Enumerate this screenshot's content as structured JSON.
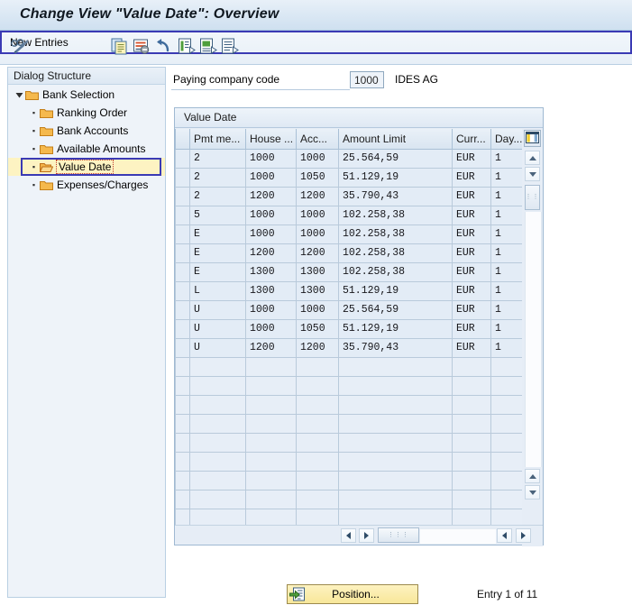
{
  "window": {
    "title": "Change View \"Value Date\": Overview"
  },
  "toolbar": {
    "display_change_icon": "glasses-pencil-icon",
    "new_entries_label": "New Entries",
    "icons": [
      {
        "name": "copy-as-icon",
        "title": "Copy As..."
      },
      {
        "name": "delete-icon",
        "title": "Delete"
      },
      {
        "name": "undo-icon",
        "title": "Undo Change"
      },
      {
        "name": "select-all-icon",
        "title": "Select All"
      },
      {
        "name": "select-block-icon",
        "title": "Select Block"
      },
      {
        "name": "deselect-all-icon",
        "title": "Deselect All"
      }
    ]
  },
  "sidebar": {
    "header": "Dialog Structure",
    "items": [
      {
        "label": "Bank Selection",
        "level": 0,
        "expanded": true,
        "selected": false
      },
      {
        "label": "Ranking Order",
        "level": 1,
        "expanded": false,
        "selected": false
      },
      {
        "label": "Bank Accounts",
        "level": 1,
        "expanded": false,
        "selected": false
      },
      {
        "label": "Available Amounts",
        "level": 1,
        "expanded": false,
        "selected": false
      },
      {
        "label": "Value Date",
        "level": 1,
        "expanded": false,
        "selected": true
      },
      {
        "label": "Expenses/Charges",
        "level": 1,
        "expanded": false,
        "selected": false
      }
    ]
  },
  "form": {
    "company_code_label": "Paying company code",
    "company_code_value": "1000",
    "company_name": "IDES AG"
  },
  "table": {
    "caption": "Value Date",
    "columns": [
      {
        "key": "pmt",
        "label": "Pmt me..."
      },
      {
        "key": "house",
        "label": "House ..."
      },
      {
        "key": "acc",
        "label": "Acc..."
      },
      {
        "key": "amt",
        "label": "Amount Limit"
      },
      {
        "key": "curr",
        "label": "Curr..."
      },
      {
        "key": "day",
        "label": "Day..."
      }
    ],
    "rows": [
      {
        "pmt": "2",
        "house": "1000",
        "acc": "1000",
        "amt": "25.564,59",
        "curr": "EUR",
        "day": "1"
      },
      {
        "pmt": "2",
        "house": "1000",
        "acc": "1050",
        "amt": "51.129,19",
        "curr": "EUR",
        "day": "1"
      },
      {
        "pmt": "2",
        "house": "1200",
        "acc": "1200",
        "amt": "35.790,43",
        "curr": "EUR",
        "day": "1"
      },
      {
        "pmt": "5",
        "house": "1000",
        "acc": "1000",
        "amt": "102.258,38",
        "curr": "EUR",
        "day": "1"
      },
      {
        "pmt": "E",
        "house": "1000",
        "acc": "1000",
        "amt": "102.258,38",
        "curr": "EUR",
        "day": "1"
      },
      {
        "pmt": "E",
        "house": "1200",
        "acc": "1200",
        "amt": "102.258,38",
        "curr": "EUR",
        "day": "1"
      },
      {
        "pmt": "E",
        "house": "1300",
        "acc": "1300",
        "amt": "102.258,38",
        "curr": "EUR",
        "day": "1"
      },
      {
        "pmt": "L",
        "house": "1300",
        "acc": "1300",
        "amt": "51.129,19",
        "curr": "EUR",
        "day": "1"
      },
      {
        "pmt": "U",
        "house": "1000",
        "acc": "1000",
        "amt": "25.564,59",
        "curr": "EUR",
        "day": "1"
      },
      {
        "pmt": "U",
        "house": "1000",
        "acc": "1050",
        "amt": "51.129,19",
        "curr": "EUR",
        "day": "1"
      },
      {
        "pmt": "U",
        "house": "1200",
        "acc": "1200",
        "amt": "35.790,43",
        "curr": "EUR",
        "day": "1"
      }
    ],
    "empty_row_count": 10,
    "column_config_icon": "column-config-icon"
  },
  "footer": {
    "position_label": "Position...",
    "position_icon": "position-jump-icon",
    "entry_status": "Entry 1 of 11"
  },
  "colors": {
    "focus_ring": "#3a3ab4",
    "selection_bg": "#fdf3c2",
    "selection_text_border": "#c03b2b",
    "folder": "#f0a83c",
    "button_yellow": "#f8e79a",
    "titlebar": "#dbe8f4"
  }
}
